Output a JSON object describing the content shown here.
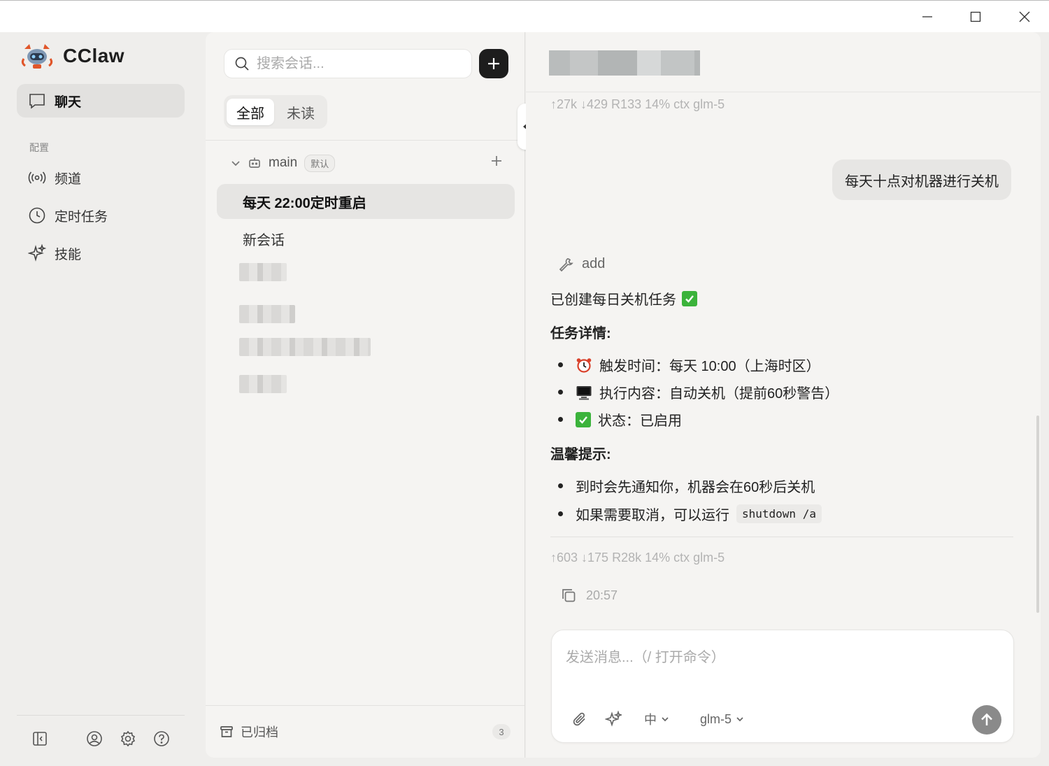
{
  "app": {
    "name": "CClaw"
  },
  "window": {
    "minimize": "minimize",
    "maximize": "maximize",
    "close": "close"
  },
  "sidebar": {
    "primary": {
      "label": "聊天",
      "icon": "chat-bubble-icon"
    },
    "section_label": "配置",
    "items": [
      {
        "label": "频道",
        "icon": "broadcast-icon"
      },
      {
        "label": "定时任务",
        "icon": "clock-icon"
      },
      {
        "label": "技能",
        "icon": "sparkle-icon"
      }
    ],
    "footer_icons": [
      "sidebar-toggle-icon",
      "user-icon",
      "gear-icon",
      "help-icon"
    ]
  },
  "conversations": {
    "search_placeholder": "搜索会话...",
    "tabs": [
      {
        "label": "全部",
        "active": true
      },
      {
        "label": "未读",
        "active": false
      }
    ],
    "group": {
      "name": "main",
      "badge": "默认"
    },
    "items": [
      {
        "title": "每天 22:00定时重启",
        "active": true
      },
      {
        "title": "新会话",
        "active": false
      }
    ],
    "archived_label": "已归档",
    "archived_count": "3"
  },
  "chat": {
    "meta_top": "↑27k ↓429 R133 14% ctx glm-5",
    "user_message": "每天十点对机器进行关机",
    "tool_name": "add",
    "reply": {
      "line1": "已创建每日关机任务",
      "details_heading": "任务详情:",
      "details": [
        {
          "icon": "alarm-clock-icon",
          "text": "触发时间：每天 10:00（上海时区）"
        },
        {
          "icon": "computer-icon",
          "text": "执行内容：自动关机（提前60秒警告）"
        },
        {
          "icon": "check-mark-icon",
          "text": "状态：已启用"
        }
      ],
      "tips_heading": "温馨提示:",
      "tips": [
        {
          "text": "到时会先通知你，机器会在60秒后关机"
        },
        {
          "text": "如果需要取消，可以运行",
          "code": "shutdown /a"
        }
      ]
    },
    "meta_bottom": "↑603 ↓175 R28k 14% ctx glm-5",
    "time": "20:57",
    "composer": {
      "placeholder": "发送消息...（/ 打开命令）",
      "lang": "中",
      "model": "glm-5"
    }
  },
  "colors": {
    "accent_dark": "#1d1d1d",
    "check_green": "#3bb33b",
    "send_button": "#8a8a8a"
  }
}
